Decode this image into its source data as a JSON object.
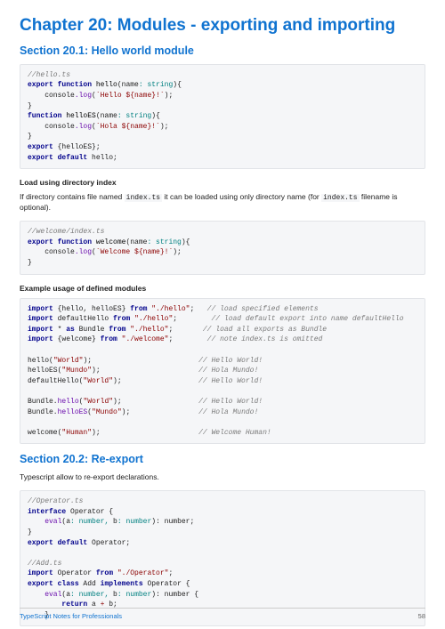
{
  "chapter_title": "Chapter 20: Modules - exporting and importing",
  "section1": {
    "title": "Section 20.1: Hello world module",
    "code1": {
      "c1": "//hello.ts",
      "l2a": "export",
      "l2b": "function",
      "l2c": " hello",
      "l2d": "(",
      "l2e": "name",
      "l2f": ": string",
      "l2g": "){",
      "l3a": "    console",
      "l3b": ".log",
      "l3c": "(",
      "l3d": "`Hello ${name}!`",
      "l3e": ");",
      "l4": "}",
      "l5a": "function",
      "l5b": " helloES",
      "l5c": "(",
      "l5d": "name",
      "l5e": ": string",
      "l5f": "){",
      "l6a": "    console",
      "l6b": ".log",
      "l6c": "(",
      "l6d": "`Hola ${name}!`",
      "l6e": ");",
      "l7": "}",
      "l8a": "export",
      "l8b": " {helloES};",
      "l9a": "export",
      "l9b": " default",
      "l9c": " hello;"
    },
    "sub1": "Load using directory index",
    "para1a": "If directory contains file named ",
    "para1b": "index.ts",
    "para1c": " it can be loaded using only directory name (for ",
    "para1d": "index.ts",
    "para1e": " filename is optional).",
    "code2": {
      "c1": "//welcome/index.ts",
      "l2a": "export",
      "l2b": "function",
      "l2c": " welcome",
      "l2d": "(",
      "l2e": "name",
      "l2f": ": string",
      "l2g": "){",
      "l3a": "    console",
      "l3b": ".log",
      "l3c": "(",
      "l3d": "`Welcome ${name}!`",
      "l3e": ");",
      "l4": "}"
    },
    "sub2": "Example usage of defined modules",
    "code3": {
      "l1a": "import",
      "l1b": " {hello, helloES} ",
      "l1c": "from",
      "l1d": "\"./hello\"",
      "l1e": ";   ",
      "l1f": "// load specified elements",
      "l2a": "import",
      "l2b": " defaultHello ",
      "l2c": "from",
      "l2d": "\"./hello\"",
      "l2e": ";        ",
      "l2f": "// load default export into name defaultHello",
      "l3a": "import",
      "l3b": " * ",
      "l3c": "as",
      "l3d": " Bundle ",
      "l3e": "from",
      "l3f": "\"./hello\"",
      "l3g": ";       ",
      "l3h": "// load all exports as Bundle",
      "l4a": "import",
      "l4b": " {welcome} ",
      "l4c": "from",
      "l4d": "\"./welcome\"",
      "l4e": ";        ",
      "l4f": "// note index.ts is omitted",
      "l5": "",
      "l6a": "hello",
      "l6b": "(",
      "l6c": "\"World\"",
      "l6d": ");                         ",
      "l6e": "// Hello World!",
      "l7a": "helloES",
      "l7b": "(",
      "l7c": "\"Mundo\"",
      "l7d": ");                       ",
      "l7e": "// Hola Mundo!",
      "l8a": "defaultHello",
      "l8b": "(",
      "l8c": "\"World\"",
      "l8d": ");                  ",
      "l8e": "// Hello World!",
      "l9": "",
      "l10a": "Bundle.",
      "l10b": "hello",
      "l10c": "(",
      "l10d": "\"World\"",
      "l10e": ");                  ",
      "l10f": "// Hello World!",
      "l11a": "Bundle.",
      "l11b": "helloES",
      "l11c": "(",
      "l11d": "\"Mundo\"",
      "l11e": ");                ",
      "l11f": "// Hola Mundo!",
      "l12": "",
      "l13a": "welcome",
      "l13b": "(",
      "l13c": "\"Human\"",
      "l13d": ");                       ",
      "l13e": "// Welcome Human!"
    }
  },
  "section2": {
    "title": "Section 20.2: Re-export",
    "para": "Typescript allow to re-export declarations.",
    "code1": {
      "c1": "//Operator.ts",
      "l2a": "interface",
      "l2b": " Operator {",
      "l3a": "    eval",
      "l3b": "(",
      "l3c": "a",
      "l3d": ": number, ",
      "l3e": "b",
      "l3f": ": number",
      "l3g": "): number;",
      "l4": "}",
      "l5a": "export",
      "l5b": " default",
      "l5c": " Operator;",
      "l6": "",
      "c2": "//Add.ts",
      "l8a": "import",
      "l8b": " Operator ",
      "l8c": "from",
      "l8d": "\"./Operator\"",
      "l8e": ";",
      "l9a": "export",
      "l9b": " class",
      "l9c": " Add ",
      "l9d": "implements",
      "l9e": " Operator {",
      "l10a": "    eval",
      "l10b": "(",
      "l10c": "a",
      "l10d": ": number, ",
      "l10e": "b",
      "l10f": ": number",
      "l10g": "): number {",
      "l11a": "        return",
      "l11b": " a ",
      "l11c": "+",
      "l11d": " b;",
      "l12": "    }"
    }
  },
  "footer": {
    "left": "TypeScript Notes for Professionals",
    "page": "58"
  }
}
